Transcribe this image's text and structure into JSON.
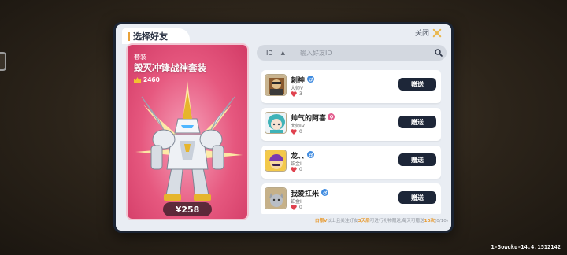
{
  "modal": {
    "title": "选择好友",
    "close_label": "关闭"
  },
  "item": {
    "type": "套装",
    "name": "毁灭冲锋战神套装",
    "score": "2460",
    "price": "¥258",
    "bg_color": "#e6587f"
  },
  "search": {
    "filter_value": "ID",
    "placeholder": "输入好友ID"
  },
  "friends": [
    {
      "name": "刺神",
      "gender": "male",
      "rank": "大师V",
      "likes": "3",
      "gift_label": "赠送",
      "avatar": "ninja-avatar"
    },
    {
      "name": "帅气的阿喜",
      "gender": "female",
      "rank": "大师IV",
      "likes": "0",
      "gift_label": "赠送",
      "avatar": "teal-hair-girl-avatar"
    },
    {
      "name": "龙、、",
      "gender": "male",
      "rank": "铂金I",
      "likes": "0",
      "gift_label": "赠送",
      "avatar": "purple-beanie-avatar"
    },
    {
      "name": "我爱扛米",
      "gender": "male",
      "rank": "铂金II",
      "likes": "0",
      "gift_label": "赠送",
      "avatar": "gray-cat-avatar"
    }
  ],
  "footer": {
    "prefix": "白银V",
    "text1": "以上且关注好友",
    "days": "3天后",
    "text2": "可进行礼物赠送,每天可赠送",
    "times": "10次",
    "count": "(0/10)"
  },
  "version": "1-3owuku-14.4.1512142",
  "colors": {
    "accent": "#e9a23a",
    "button": "#1d2638",
    "male": "#3f8be0",
    "female": "#e35d8e"
  }
}
